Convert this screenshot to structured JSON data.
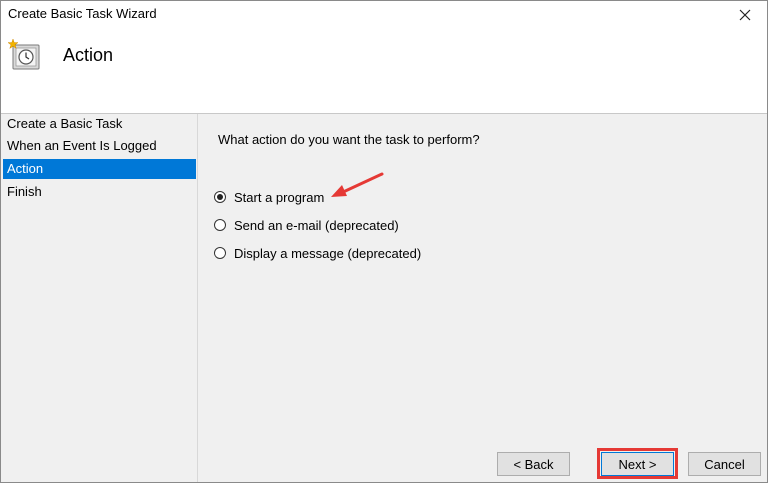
{
  "window": {
    "title": "Create Basic Task Wizard"
  },
  "header": {
    "title": "Action"
  },
  "sidebar": {
    "items": [
      {
        "label": "Create a Basic Task",
        "active": false
      },
      {
        "label": "When an Event Is Logged",
        "active": false
      },
      {
        "label": "Action",
        "active": true
      },
      {
        "label": "Finish",
        "active": false
      }
    ]
  },
  "content": {
    "question": "What action do you want the task to perform?",
    "options": [
      {
        "label": "Start a program",
        "selected": true
      },
      {
        "label": "Send an e-mail (deprecated)",
        "selected": false
      },
      {
        "label": "Display a message (deprecated)",
        "selected": false
      }
    ]
  },
  "buttons": {
    "back": "< Back",
    "next": "Next >",
    "cancel": "Cancel"
  },
  "colors": {
    "accent": "#0078d7",
    "annotation": "#e53935"
  },
  "icons": {
    "close": "close-icon",
    "task": "task-scheduler-clock-icon",
    "arrow": "annotation-arrow-icon"
  }
}
